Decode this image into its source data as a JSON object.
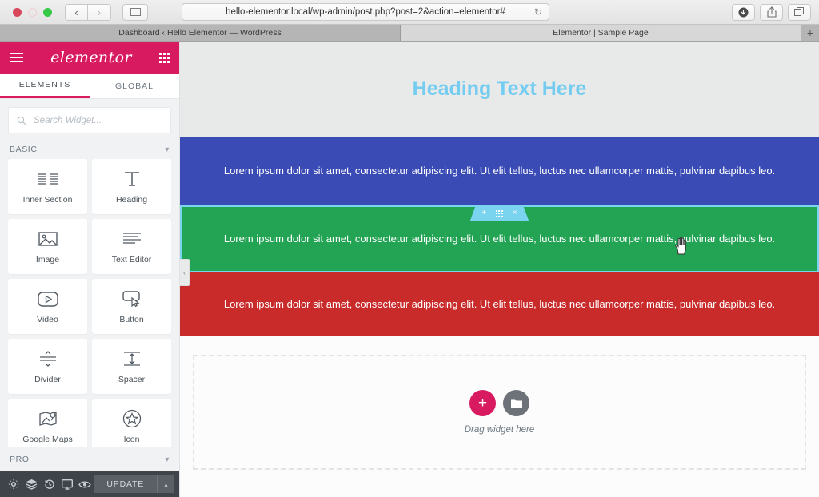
{
  "browser": {
    "url": "hello-elementor.local/wp-admin/post.php?post=2&action=elementor#",
    "reload_glyph": "↻",
    "back_glyph": "‹",
    "forward_glyph": "›",
    "tabs": [
      {
        "title": "Dashboard ‹ Hello Elementor — WordPress",
        "active": false
      },
      {
        "title": "Elementor | Sample Page",
        "active": true
      }
    ],
    "new_tab_glyph": "+"
  },
  "panel": {
    "logo": "elementor",
    "tabs": [
      {
        "label": "ELEMENTS",
        "active": true
      },
      {
        "label": "GLOBAL",
        "active": false
      }
    ],
    "search": {
      "placeholder": "Search Widget...",
      "value": ""
    },
    "categories": [
      {
        "label": "BASIC",
        "expanded": true
      },
      {
        "label": "PRO",
        "expanded": false
      }
    ],
    "widgets": [
      {
        "label": "Inner Section",
        "icon": "columns-icon"
      },
      {
        "label": "Heading",
        "icon": "heading-t-icon"
      },
      {
        "label": "Image",
        "icon": "image-icon"
      },
      {
        "label": "Text Editor",
        "icon": "text-lines-icon"
      },
      {
        "label": "Video",
        "icon": "video-play-icon"
      },
      {
        "label": "Button",
        "icon": "button-cursor-icon"
      },
      {
        "label": "Divider",
        "icon": "divider-icon"
      },
      {
        "label": "Spacer",
        "icon": "spacer-icon"
      },
      {
        "label": "Google Maps",
        "icon": "map-pin-icon"
      },
      {
        "label": "Icon",
        "icon": "star-circle-icon"
      }
    ],
    "footer": {
      "icons": [
        "gear-icon",
        "layers-icon",
        "history-icon",
        "responsive-icon",
        "preview-eye-icon"
      ],
      "update_label": "UPDATE",
      "update_caret_glyph": "▴"
    },
    "collapse_glyph": "‹"
  },
  "canvas": {
    "heading": "Heading Text Here",
    "sections": [
      {
        "name": "blue",
        "color": "#3a4bb5",
        "text": "Lorem ipsum dolor sit amet, consectetur adipiscing elit. Ut elit tellus, luctus nec ullamcorper mattis, pulvinar dapibus leo."
      },
      {
        "name": "green",
        "color": "#23a455",
        "text": "Lorem ipsum dolor sit amet, consectetur adipiscing elit. Ut elit tellus, luctus nec ullamcorper mattis, pulvinar dapibus leo."
      },
      {
        "name": "red",
        "color": "#c92a2a",
        "text": "Lorem ipsum dolor sit amet, consectetur adipiscing elit. Ut elit tellus, luctus nec ullamcorper mattis, pulvinar dapibus leo."
      }
    ],
    "section_toolbar": {
      "add_glyph": "+",
      "drag_handle": "grip-dots-icon",
      "close_glyph": "×",
      "accent": "#7ad4ef"
    },
    "drop_zone": {
      "add_glyph": "+",
      "folder_icon": "folder-icon",
      "label": "Drag widget here"
    }
  },
  "colors": {
    "elementor_pink": "#d81b60",
    "heading_blue": "#74cdf0",
    "section_blue": "#3a4bb5",
    "section_green": "#23a455",
    "section_red": "#c92a2a",
    "highlight": "#7ad4ef"
  }
}
